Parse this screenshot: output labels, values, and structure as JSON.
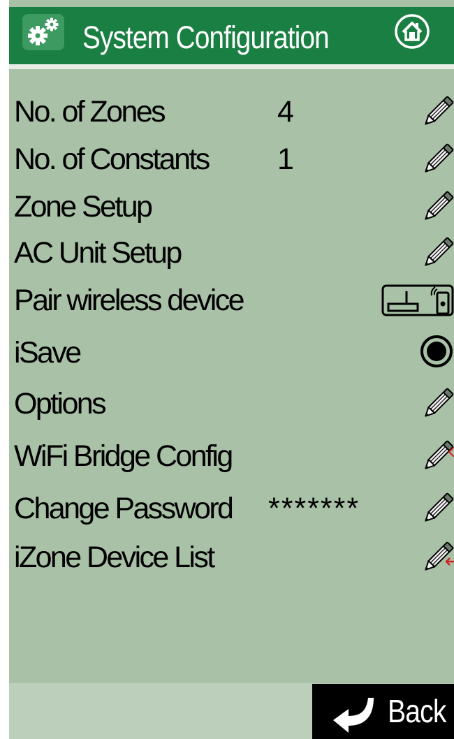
{
  "header": {
    "title": "System Configuration",
    "colors": {
      "background": "#1a7f42",
      "text": "#ffffff"
    },
    "icons": {
      "left": "gear-icon",
      "right": "home-icon"
    }
  },
  "settings": {
    "items": [
      {
        "label": "No. of Zones",
        "value": "4",
        "action_icon": "edit-icon"
      },
      {
        "label": "No. of Constants",
        "value": "1",
        "action_icon": "edit-icon"
      },
      {
        "label": "Zone Setup",
        "value": "",
        "action_icon": "edit-icon"
      },
      {
        "label": "AC Unit Setup",
        "value": "",
        "action_icon": "edit-icon"
      },
      {
        "label": "Pair wireless device",
        "value": "",
        "action_icon": "wireless-pair-icon"
      },
      {
        "label": "iSave",
        "value": "",
        "action_icon": "radio-selected-icon"
      },
      {
        "label": "Options",
        "value": "",
        "action_icon": "edit-icon"
      },
      {
        "label": "WiFi Bridge Config",
        "value": "",
        "action_icon": "edit-icon"
      },
      {
        "label": "Change Password",
        "value": "*******",
        "action_icon": "edit-icon"
      },
      {
        "label": "iZone Device List",
        "value": "",
        "action_icon": "edit-icon"
      }
    ],
    "background": "#a9c2a7"
  },
  "footer": {
    "back_label": "Back",
    "back_icon": "back-arrow-icon"
  }
}
